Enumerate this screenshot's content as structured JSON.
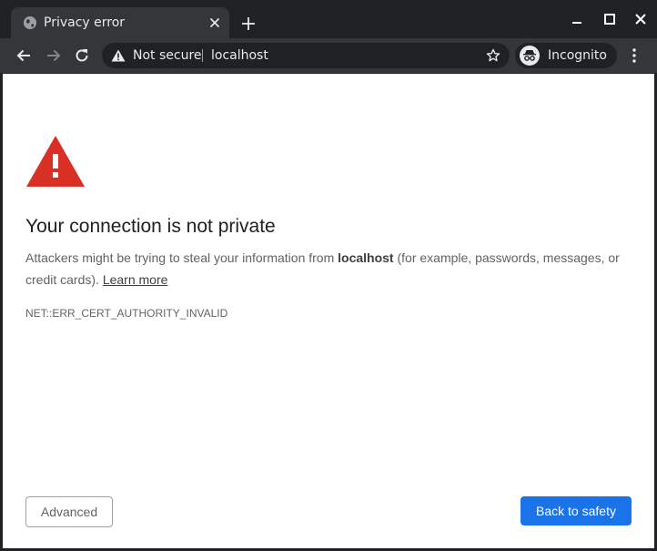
{
  "tab": {
    "title": "Privacy error",
    "icon": "globe-icon"
  },
  "window_controls": [
    "minimize-icon",
    "maximize-icon",
    "close-icon"
  ],
  "omnibox": {
    "security_label": "Not secure",
    "url": "localhost",
    "security_icon": "warning-icon"
  },
  "profile": {
    "label": "Incognito",
    "icon": "incognito-icon"
  },
  "colors": {
    "chrome_dark": "#202124",
    "toolbar": "#35363a",
    "warning_red": "#d93025",
    "primary_blue": "#1a73e8"
  },
  "page": {
    "heading": "Your connection is not private",
    "desc_part1": "Attackers might be trying to steal your information from ",
    "desc_host": "localhost",
    "desc_part2": " (for example, passwords, messages, or credit cards). ",
    "learn_more": "Learn more",
    "error_code": "NET::ERR_CERT_AUTHORITY_INVALID",
    "advanced_label": "Advanced",
    "back_label": "Back to safety"
  }
}
